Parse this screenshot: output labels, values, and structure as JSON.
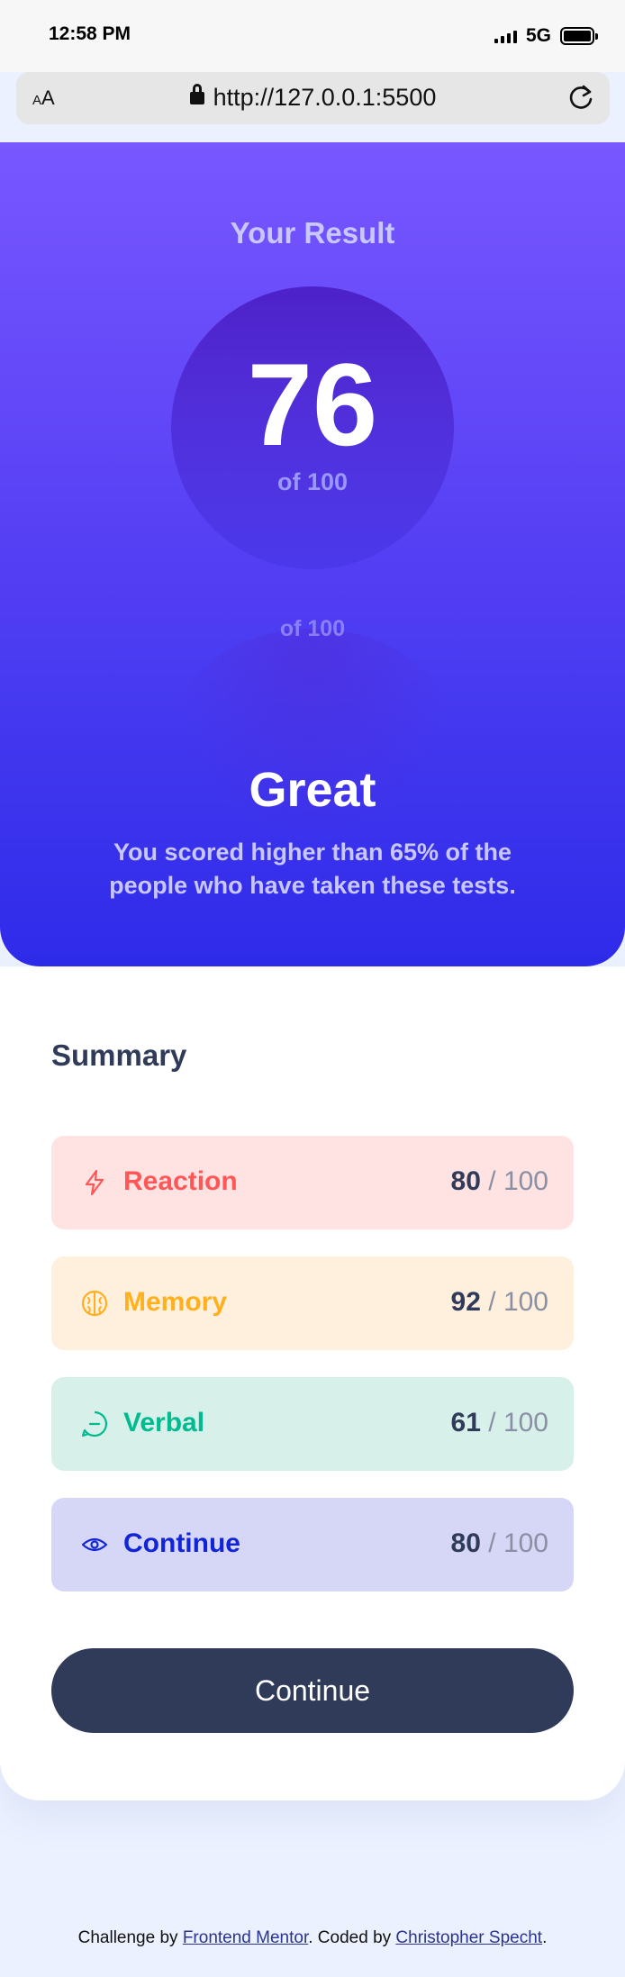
{
  "status_bar": {
    "time": "12:58 PM",
    "network": "5G"
  },
  "browser": {
    "aa_label_small": "A",
    "aa_label": "A",
    "url": "http://127.0.0.1:5500"
  },
  "result": {
    "title": "Your Result",
    "score": "76",
    "of_total": "of 100",
    "rating": "Great",
    "description": "You scored higher than 65% of the people who have taken these tests."
  },
  "summary": {
    "title": "Summary",
    "items": [
      {
        "label": "Reaction",
        "score": "80",
        "slash": "/",
        "max": "100",
        "icon": "lightning-icon",
        "color": "#ff5757",
        "bg": "#ffe3e3"
      },
      {
        "label": "Memory",
        "score": "92",
        "slash": "/",
        "max": "100",
        "icon": "brain-icon",
        "color": "#ffb01f",
        "bg": "#fff0de"
      },
      {
        "label": "Verbal",
        "score": "61",
        "slash": "/",
        "max": "100",
        "icon": "chat-bubble-icon",
        "color": "#00bb8f",
        "bg": "#d7f1ea"
      },
      {
        "label": "Continue",
        "score": "80",
        "slash": "/",
        "max": "100",
        "icon": "eye-icon",
        "color": "#1125d6",
        "bg": "#d6d7f6"
      }
    ],
    "continue_label": "Continue"
  },
  "footer": {
    "prefix": "Challenge by ",
    "link1": "Frontend Mentor",
    "middle": ". Coded by ",
    "link2": "Christopher Specht",
    "suffix": "."
  },
  "colors": {
    "purple_top": "#7857ff",
    "purple_bottom": "#2e2be9",
    "dark_navy": "#303b5a"
  }
}
